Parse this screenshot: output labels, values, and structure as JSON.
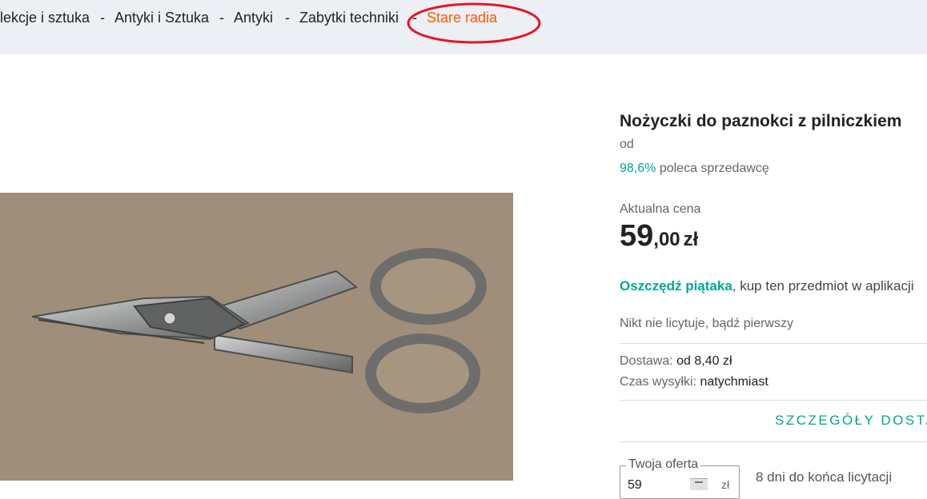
{
  "breadcrumb": {
    "items": [
      "lekcje i sztuka",
      "Antyki i Sztuka",
      "Antyki",
      "Zabytki techniki",
      "Stare radia"
    ],
    "separator": "-",
    "active_color": "#ff5a00",
    "annotation_color": "#e0182b"
  },
  "product": {
    "title": "Nożyczki do paznokci z pilniczkiem",
    "seller_from": "od",
    "rating_percent": "98,6%",
    "rating_text": " poleca sprzedawcę",
    "image_icon": "scissors-photo"
  },
  "price": {
    "label": "Aktualna cena",
    "main": "59",
    "decimal": ",00",
    "currency": "zł"
  },
  "promo": {
    "strong": "Oszczędź piątaka",
    "text": ", kup ten przedmiot w aplikacji"
  },
  "bidding": {
    "status": "Nikt nie licytuje, bądź pierwszy",
    "offer_label": "Twoja oferta",
    "offer_value": "59",
    "offer_currency": "zł",
    "countdown": "8 dni do końca licytacji"
  },
  "shipping": {
    "delivery_label": "Dostawa: ",
    "delivery_value": "od 8,40 zł",
    "time_label": "Czas wysyłki: ",
    "time_value": "natychmiast",
    "details_link": "SZCZEGÓŁY DOSTA"
  },
  "colors": {
    "accent": "#00a790",
    "breadcrumb_bg": "#eceff3"
  }
}
